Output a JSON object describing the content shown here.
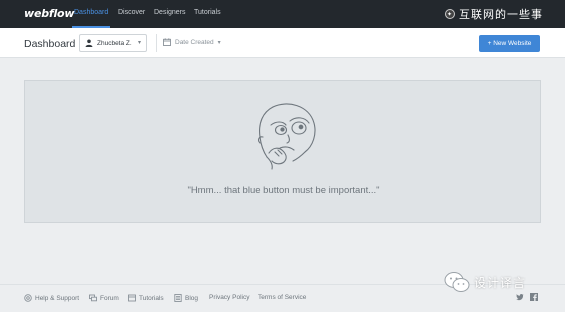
{
  "brand": {
    "name": "webflow"
  },
  "nav": {
    "items": [
      {
        "label": "Dashboard",
        "active": true
      },
      {
        "label": "Discover",
        "active": false
      },
      {
        "label": "Designers",
        "active": false
      },
      {
        "label": "Tutorials",
        "active": false
      }
    ],
    "accent_color": "#4a90e2"
  },
  "watermark_top": {
    "text": "互联网的一些事",
    "icon": "globe-icon"
  },
  "header": {
    "title": "Dashboard",
    "user_selector": {
      "value": "Zhucbeta Z.",
      "icon": "person-icon"
    },
    "sort_selector": {
      "value": "Date Created",
      "icon": "calendar-icon"
    },
    "new_button": {
      "label": "+ New Website",
      "color": "#3f86d6"
    }
  },
  "empty_state": {
    "message": "\"Hmm... that blue button must be important...\"",
    "illustration": "thinking-face-icon"
  },
  "footer": {
    "links": [
      {
        "label": "Help & Support",
        "icon": "help-icon"
      },
      {
        "label": "Forum",
        "icon": "forum-icon"
      },
      {
        "label": "Tutorials",
        "icon": "tutorials-icon"
      },
      {
        "label": "Blog",
        "icon": "blog-icon"
      },
      {
        "label": "Privacy Policy"
      },
      {
        "label": "Terms of Service"
      }
    ],
    "social": [
      "twitter-icon",
      "facebook-icon"
    ]
  },
  "watermark_bottom": {
    "text": "设计译言",
    "icon": "wechat-icon"
  }
}
